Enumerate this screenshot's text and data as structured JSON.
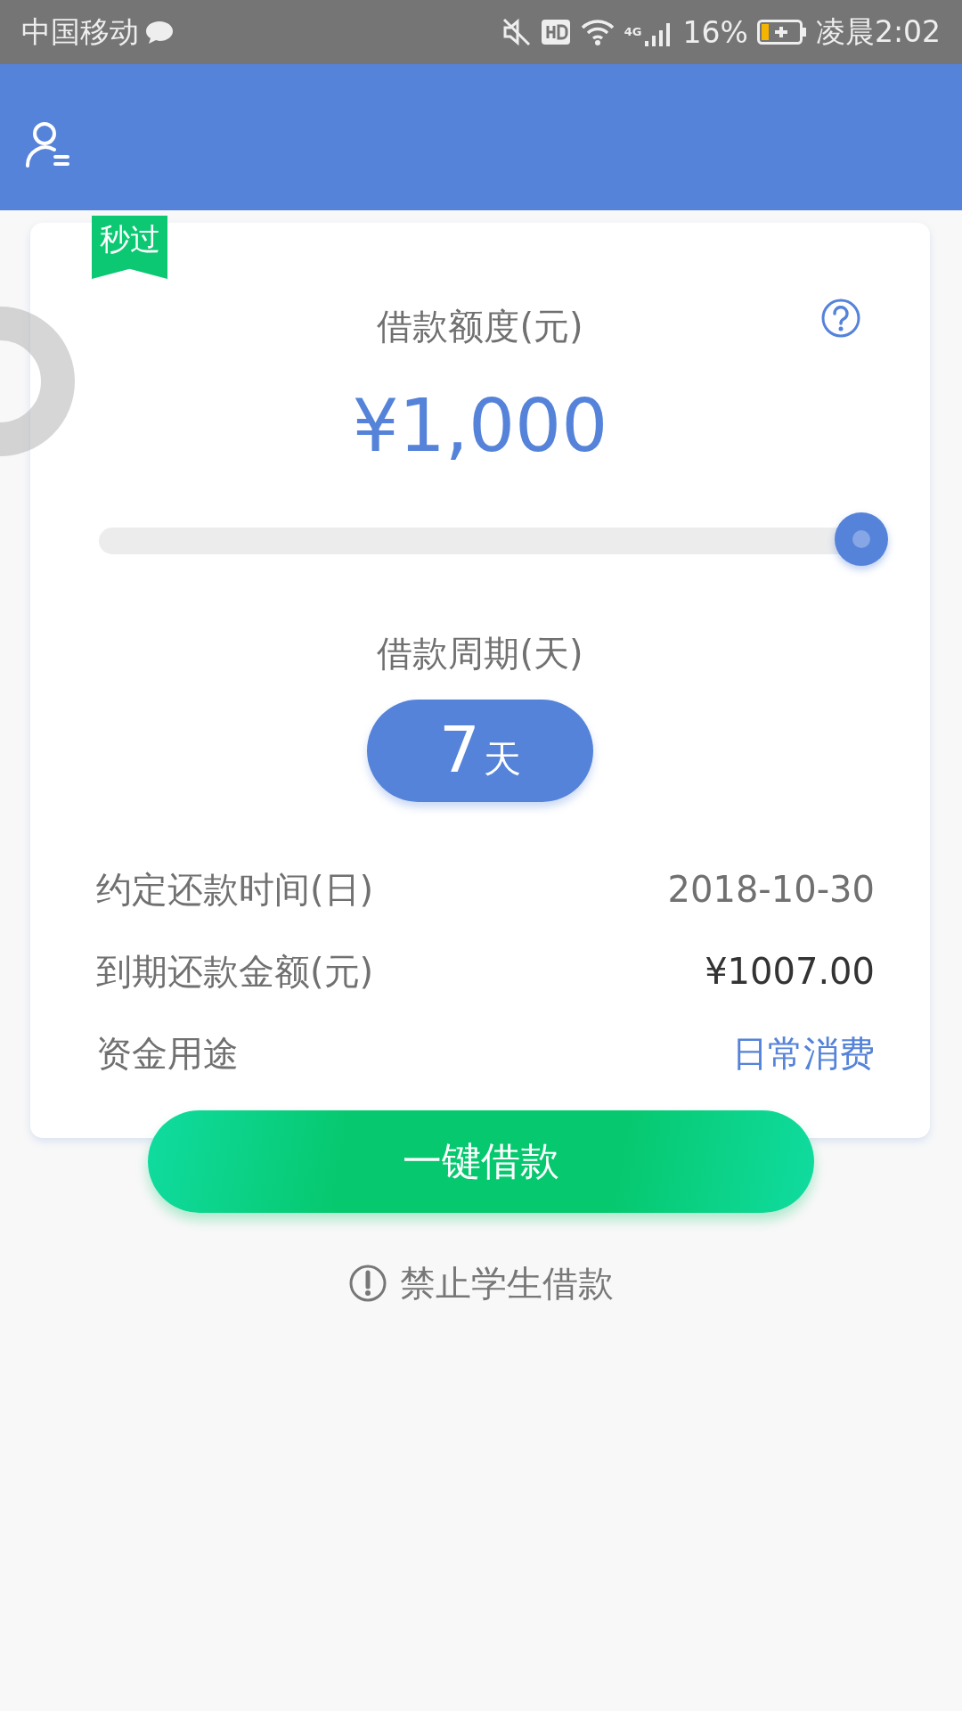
{
  "status_bar": {
    "carrier": "中国移动",
    "network": "4G",
    "battery": "16%",
    "time": "凌晨2:02"
  },
  "card": {
    "badge": "秒过",
    "amount_title": "借款额度(元)",
    "amount": "¥1,000",
    "slider": {
      "level": 1
    },
    "period_title": "借款周期(天)",
    "period": {
      "number": "7",
      "unit": "天"
    },
    "rows": [
      {
        "label": "约定还款时间(日)",
        "value": "2018-10-30",
        "kind": "plain"
      },
      {
        "label": "到期还款金额(元)",
        "value": "¥1007.00",
        "kind": "strong"
      },
      {
        "label": "资金用途",
        "value": "日常消费",
        "kind": "link"
      }
    ]
  },
  "borrow_button": "一键借款",
  "notice": "禁止学生借款"
}
